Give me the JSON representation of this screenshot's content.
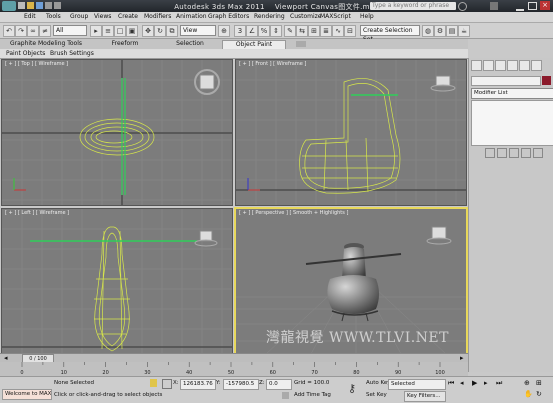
{
  "title": {
    "app": "Autodesk 3ds Max  2011",
    "file": "Viewport Canvas图文件.max",
    "search_placeholder": "Type a keyword or phrase"
  },
  "menu": [
    "Edit",
    "Tools",
    "Group",
    "Views",
    "Create",
    "Modifiers",
    "Animation",
    "Graph Editors",
    "Rendering",
    "Customize",
    "MAXScript",
    "Help"
  ],
  "toolbar": {
    "filter_value": "All",
    "view_value": "View",
    "selection_set": "Create Selection Set"
  },
  "ribbon": {
    "tabs": [
      "Graphite Modeling Tools",
      "Freeform",
      "Selection",
      "Object Paint"
    ],
    "active_tab": "Object Paint",
    "subtabs": [
      "Paint Objects",
      "Brush Settings"
    ]
  },
  "viewports": {
    "top": "[ + ] [ Top ] [ Wireframe ]",
    "front": "[ + ] [ Front ] [ Wireframe ]",
    "left": "[ + ] [ Left ] [ Wireframe ]",
    "persp": "[ + ] [ Perspective ] [ Smooth + Highlights ]"
  },
  "watermark": "灣龍視覺 WWW.TLVI.NET",
  "command_panel": {
    "modifier_list": "Modifier List"
  },
  "timeline": {
    "frame": "0 / 100",
    "ticks": [
      "0",
      "10",
      "20",
      "30",
      "40",
      "50",
      "60",
      "70",
      "80",
      "90",
      "100"
    ]
  },
  "status": {
    "welcome": "Welcome to MAX!",
    "selection": "None Selected",
    "prompt": "Click or click-and-drag to select objects",
    "x_label": "X:",
    "x_value": "126183.76",
    "y_label": "Y:",
    "y_value": "-157980.5",
    "z_label": "Z:",
    "z_value": "0.0",
    "grid": "Grid = 100.0",
    "add_time_tag": "Add Time Tag",
    "auto_key": "Auto Key",
    "set_key": "Set Key",
    "selected": "Selected",
    "key_filters": "Key Filters..."
  },
  "colors": {
    "accent": "#e8d85a",
    "viewport_bg": "#7c7c7c",
    "wire": "#d8e84a",
    "green": "#2fcf5a",
    "swatch": "#8b1a2b"
  }
}
